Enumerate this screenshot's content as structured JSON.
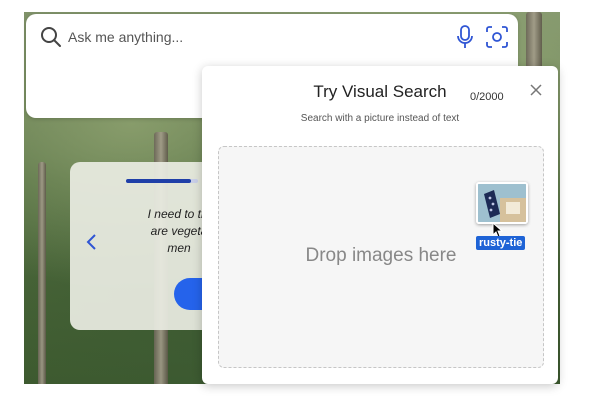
{
  "search": {
    "placeholder": "Ask me anything...",
    "value": "",
    "icons": [
      "search-icon",
      "microphone-icon",
      "camera-scan-icon"
    ]
  },
  "background_card": {
    "text": "I need to thi\nare vegeta\nmen",
    "progress": 0.9,
    "icons": [
      "chevron-left-icon"
    ]
  },
  "visual_search": {
    "title": "Try Visual Search",
    "counter": "0/2000",
    "subtitle": "Search with a picture instead of text",
    "drop_text": "Drop images here",
    "icons": [
      "close-icon"
    ]
  },
  "dragged_file": {
    "label": "rusty-tie",
    "icons": [
      "image-thumbnail",
      "cursor-icon"
    ]
  },
  "colors": {
    "accent": "#1e63d6",
    "primary_button": "#2563eb",
    "progress_fill": "#1f3fa8"
  }
}
